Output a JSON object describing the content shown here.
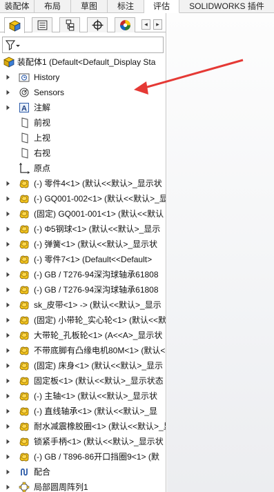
{
  "command_manager_tabs": [
    "装配体",
    "布局",
    "草图",
    "标注",
    "评估",
    "SOLIDWORKS 插件"
  ],
  "active_tab": "评估",
  "manager_tabs": [
    "featuremanager-design-tree",
    "propertymanager",
    "configurationmanager",
    "dimxpertmanager",
    "display-manager"
  ],
  "tree": {
    "root": "装配体1  (Default<Default_Display Sta",
    "items": [
      {
        "label": "History",
        "icon": "history-folder-icon"
      },
      {
        "label": "Sensors",
        "icon": "sensors-icon"
      },
      {
        "label": "注解",
        "icon": "annotations-icon"
      },
      {
        "label": "前视",
        "icon": "plane-icon"
      },
      {
        "label": "上视",
        "icon": "plane-icon"
      },
      {
        "label": "右视",
        "icon": "plane-icon"
      },
      {
        "label": "原点",
        "icon": "origin-icon"
      },
      {
        "label": "(-) 零件4<1> (默认<<默认>_显示状",
        "icon": "part-icon"
      },
      {
        "label": "(-) GQ001-002<1> (默认<<默认>_显",
        "icon": "part-icon"
      },
      {
        "label": "(固定) GQ001-001<1> (默认<<默认",
        "icon": "part-icon"
      },
      {
        "label": "(-) Φ5钢球<1> (默认<<默认>_显示",
        "icon": "part-icon"
      },
      {
        "label": "(-) 弹簧<1> (默认<<默认>_显示状",
        "icon": "part-icon"
      },
      {
        "label": "(-) 零件7<1> (Default<<Default>",
        "icon": "part-icon"
      },
      {
        "label": "(-) GB / T276-94深沟球轴承61808",
        "icon": "part-icon"
      },
      {
        "label": "(-) GB / T276-94深沟球轴承61808",
        "icon": "part-icon"
      },
      {
        "label": "sk_皮带<1> -> (默认<<默认>_显示",
        "icon": "part-icon"
      },
      {
        "label": "(固定) 小带轮_实心轮<1> (默认<<默",
        "icon": "part-icon"
      },
      {
        "label": "大带轮_孔板轮<1> (A<<A>_显示状",
        "icon": "part-icon"
      },
      {
        "label": "不带底脚有凸缘电机80M<1> (默认<",
        "icon": "part-icon"
      },
      {
        "label": "(固定) 床身<1> (默认<<默认>_显示",
        "icon": "part-icon"
      },
      {
        "label": "固定板<1> (默认<<默认>_显示状态",
        "icon": "part-icon"
      },
      {
        "label": "(-) 主轴<1> (默认<<默认>_显示状",
        "icon": "part-icon"
      },
      {
        "label": "(-) 直线轴承<1> (默认<<默认>_显",
        "icon": "part-icon"
      },
      {
        "label": "耐水减震橡胶圈<1> (默认<<默认>_显",
        "icon": "part-icon"
      },
      {
        "label": "锁紧手柄<1> (默认<<默认>_显示状",
        "icon": "part-icon"
      },
      {
        "label": "(-) GB / T896-86开口挡圈9<1> (默",
        "icon": "part-icon"
      },
      {
        "label": "配合",
        "icon": "mates-icon"
      },
      {
        "label": "局部圆周阵列1",
        "icon": "circular-pattern-icon"
      }
    ]
  },
  "colors": {
    "part_yellow": "#f2c21b",
    "annotation_arrow": "#e53935",
    "tab_bg": "#f2f2f2"
  }
}
